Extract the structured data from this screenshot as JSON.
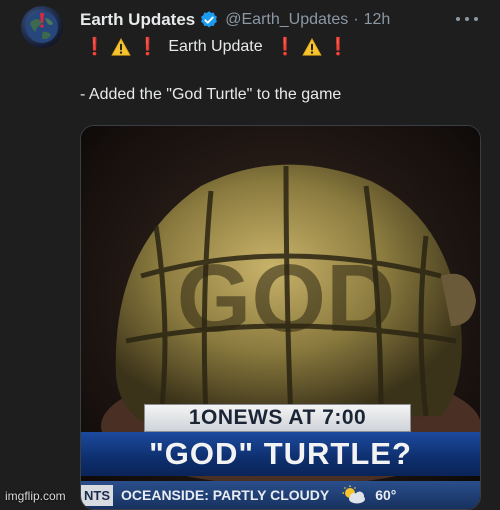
{
  "tweet": {
    "author_name": "Earth Updates",
    "handle": "@Earth_Updates",
    "separator": "·",
    "time": "12h",
    "line1": {
      "prefix_marks": [
        "❗",
        "❗"
      ],
      "title": "Earth Update",
      "suffix_marks": [
        "❗",
        "❗"
      ]
    },
    "line2": "- Added the \"God Turtle\" to the game"
  },
  "media": {
    "shell_text": "GOD",
    "news_top": "1ONEWS AT 7:00",
    "news_main": "\"GOD\" TURTLE?",
    "ticker": {
      "cut_label": "NTS",
      "text": "OCEANSIDE:  PARTLY CLOUDY",
      "temp": "60°"
    }
  },
  "icons": {
    "verified": "verified-badge-icon",
    "more": "more-options-icon",
    "warning": "warning-icon",
    "weather": "partly-cloudy-icon"
  },
  "colors": {
    "background": "#1e1e1e",
    "text": "#e7e9ea",
    "secondary_text": "#8b98a5",
    "verified_blue": "#1d9bf0",
    "exclamation_red": "#e2273a",
    "warning_yellow": "#f7c32e"
  },
  "watermark": "imgflip.com"
}
